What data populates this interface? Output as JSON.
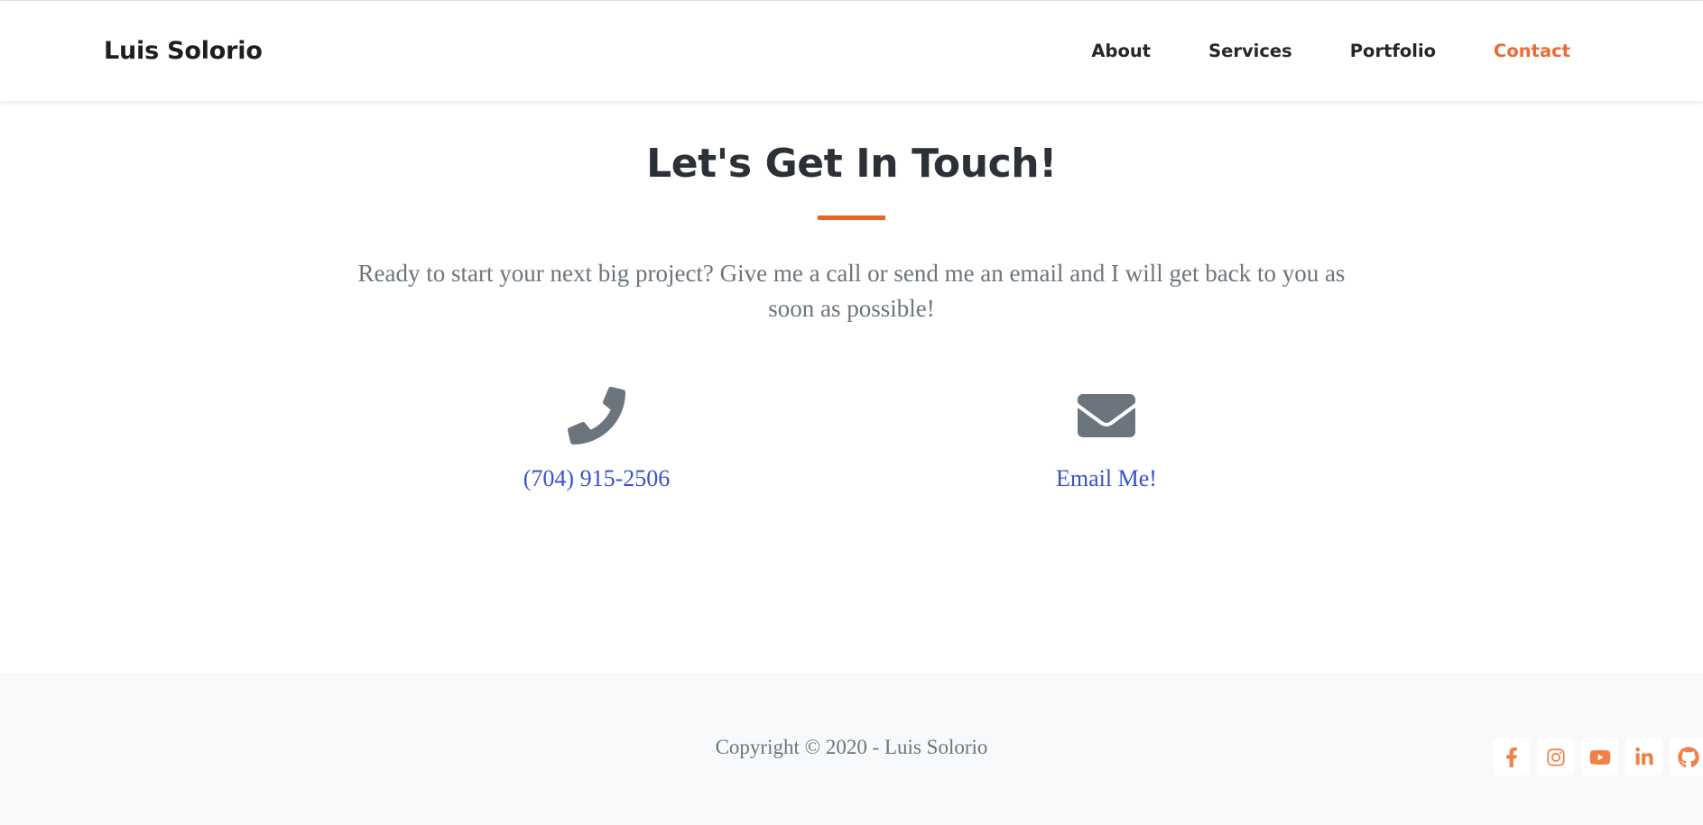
{
  "site": {
    "brand": "Luis Solorio",
    "accent_color": "#e8622c",
    "link_color": "#3a50cf",
    "muted_color": "#6c757d",
    "heading_color": "#2b3137",
    "footer_bg": "#f8f9fa"
  },
  "navbar": {
    "brand": "Luis Solorio",
    "links": [
      {
        "label": "About",
        "active": false
      },
      {
        "label": "Services",
        "active": false
      },
      {
        "label": "Portfolio",
        "active": false
      },
      {
        "label": "Contact",
        "active": true
      }
    ]
  },
  "main": {
    "title": "Let's Get In Touch!",
    "lead": "Ready to start your next big project? Give me a call or send me an email and I will get back to you as soon as possible!",
    "contacts": [
      {
        "icon": "phone-icon",
        "label": "(704) 915-2506"
      },
      {
        "icon": "envelope-icon",
        "label": "Email Me!"
      }
    ]
  },
  "footer": {
    "copyright": "Copyright © 2020 - Luis Solorio",
    "socials": [
      {
        "icon": "facebook-icon",
        "name": "Facebook"
      },
      {
        "icon": "instagram-icon",
        "name": "Instagram"
      },
      {
        "icon": "youtube-icon",
        "name": "YouTube"
      },
      {
        "icon": "linkedin-icon",
        "name": "LinkedIn"
      },
      {
        "icon": "github-icon",
        "name": "GitHub"
      }
    ]
  }
}
